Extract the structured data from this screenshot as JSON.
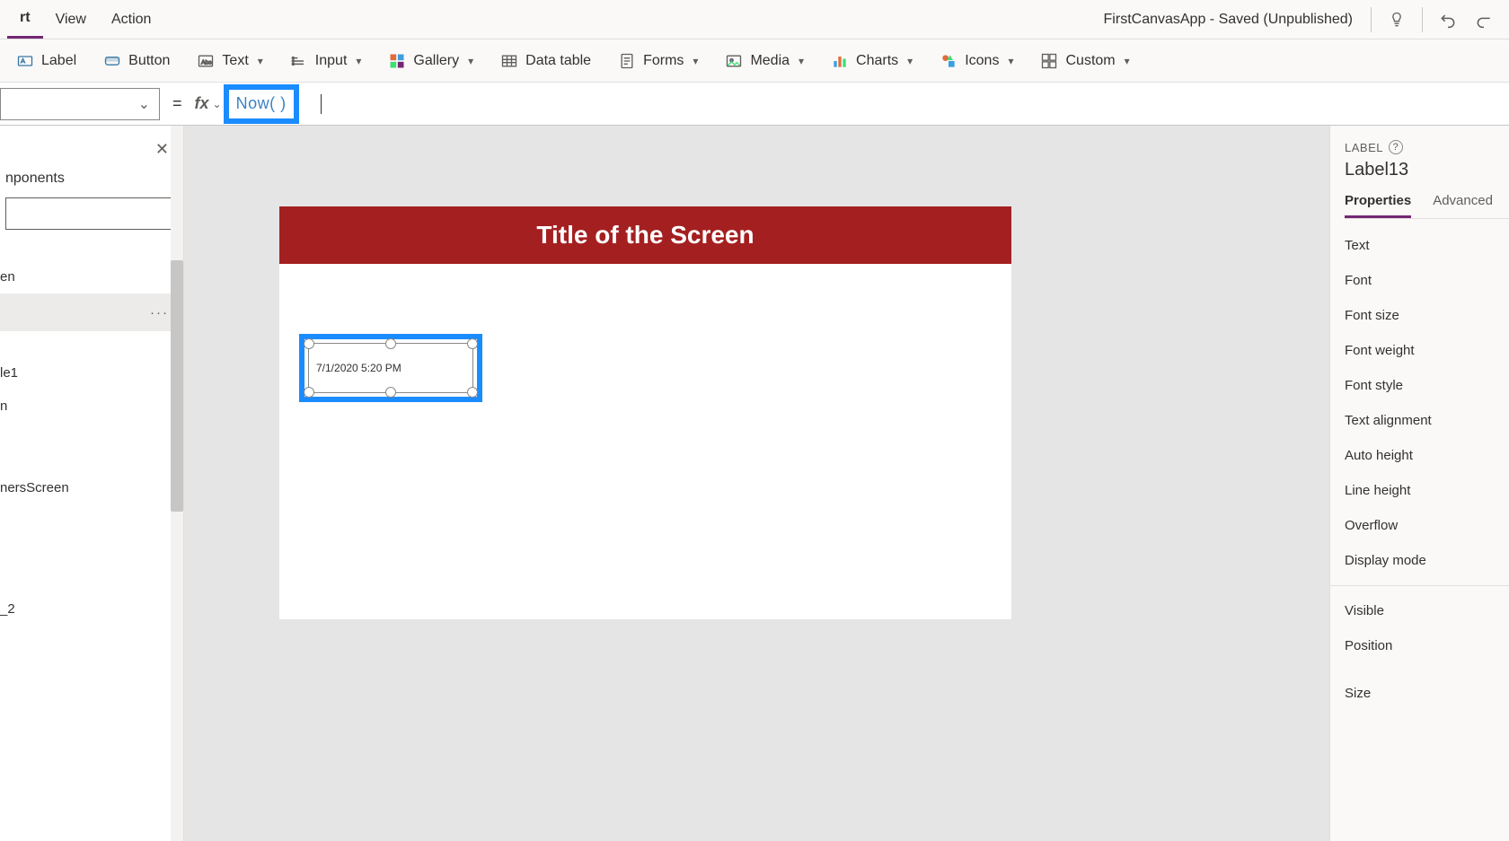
{
  "menubar": {
    "tabs": {
      "insert": "rt",
      "view": "View",
      "action": "Action"
    },
    "app_title": "FirstCanvasApp - Saved (Unpublished)"
  },
  "ribbon": {
    "label": "Label",
    "button": "Button",
    "text": "Text",
    "input": "Input",
    "gallery": "Gallery",
    "data_table": "Data table",
    "forms": "Forms",
    "media": "Media",
    "charts": "Charts",
    "icons": "Icons",
    "custom": "Custom"
  },
  "formula": {
    "equals": "=",
    "fx": "fx",
    "expression": "Now( )"
  },
  "left_panel": {
    "tab_label": "nponents",
    "tree": {
      "n0": "en",
      "n2": "le1",
      "n3": "n",
      "n4": "nersScreen",
      "n5": "_2"
    },
    "dots": "···"
  },
  "canvas": {
    "title": "Title of the Screen",
    "label_value": "7/1/2020 5:20 PM"
  },
  "right_panel": {
    "type_label": "LABEL",
    "help": "?",
    "control_name": "Label13",
    "tabs": {
      "properties": "Properties",
      "advanced": "Advanced"
    },
    "props": {
      "text": "Text",
      "font": "Font",
      "font_size": "Font size",
      "font_weight": "Font weight",
      "font_style": "Font style",
      "text_alignment": "Text alignment",
      "auto_height": "Auto height",
      "line_height": "Line height",
      "overflow": "Overflow",
      "display_mode": "Display mode",
      "visible": "Visible",
      "position": "Position",
      "size": "Size"
    }
  }
}
